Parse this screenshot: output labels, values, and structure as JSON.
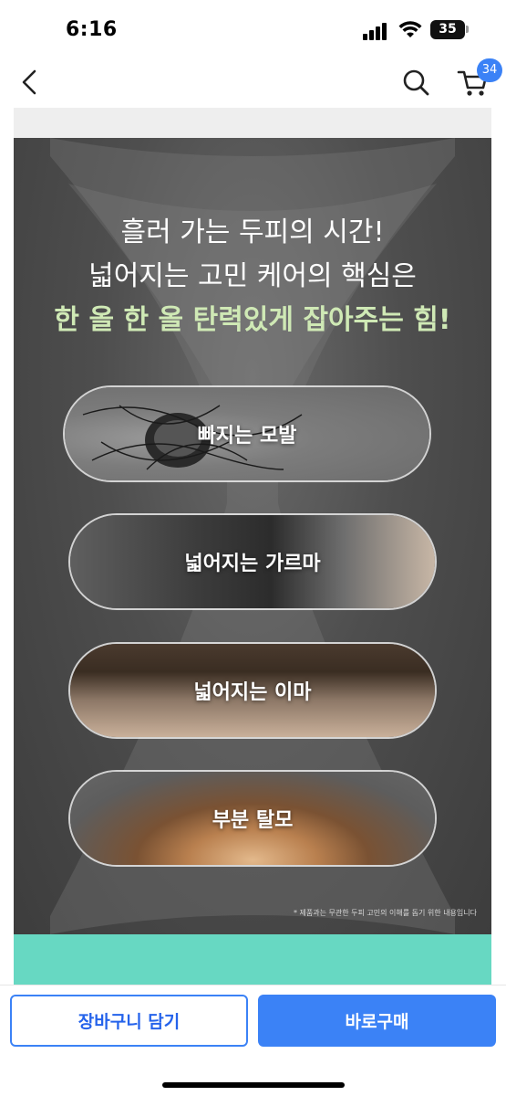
{
  "status_bar": {
    "time": "6:16",
    "battery_level": "35"
  },
  "nav": {
    "cart_count": "34"
  },
  "banner": {
    "headline_lines": [
      "흘러 가는 두피의 시간!",
      "넓어지는 고민 케어의 핵심은",
      "한 올 한 올 탄력있게 잡아주는 힘!"
    ],
    "concerns": [
      "빠지는 모발",
      "넓어지는 가르마",
      "넓어지는 이마",
      "부분 탈모"
    ],
    "footnote": "* 제품과는 무관한 두피 고민의 이해를 돕기 위한 내용입니다"
  },
  "actions": {
    "add_to_cart": "장바구니 담기",
    "buy_now": "바로구매"
  },
  "colors": {
    "accent": "#3b82f6",
    "headline_accent": "#cfe9b5",
    "mint": "#67d8c2"
  }
}
